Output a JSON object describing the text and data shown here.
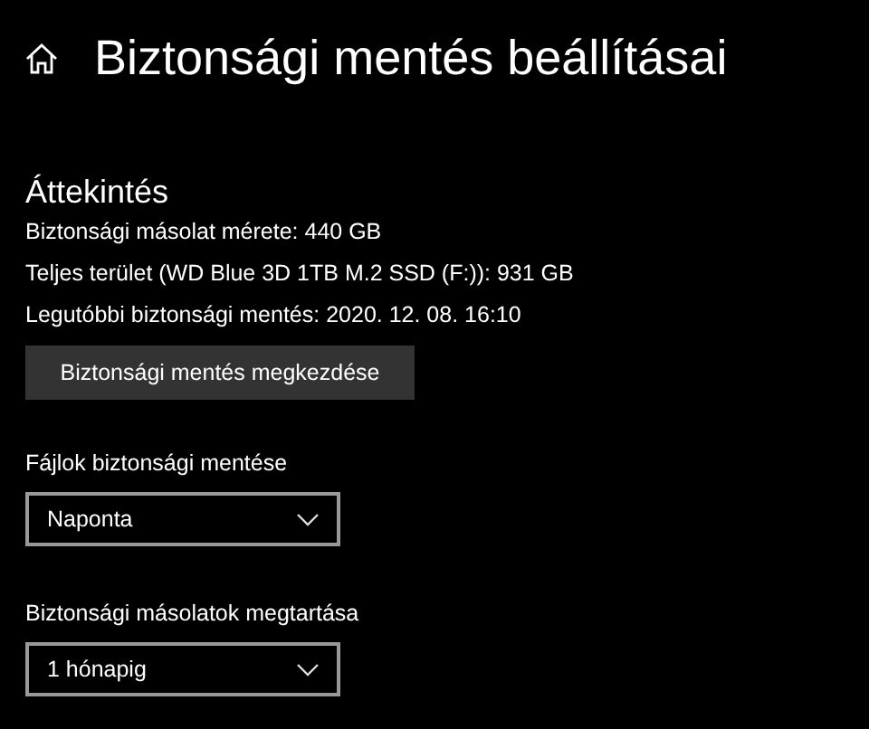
{
  "header": {
    "title": "Biztonsági mentés beállításai"
  },
  "overview": {
    "heading": "Áttekintés",
    "lines": [
      "Biztonsági másolat mérete: 440 GB",
      "Teljes terület (WD Blue 3D 1TB M.2 SSD (F:)): 931 GB",
      "Legutóbbi biztonsági mentés: 2020. 12. 08. 16:10"
    ],
    "button": "Biztonsági mentés megkezdése"
  },
  "settings": [
    {
      "label": "Fájlok biztonsági mentése",
      "value": "Naponta"
    },
    {
      "label": "Biztonsági másolatok megtartása",
      "value": "1 hónapig"
    }
  ]
}
